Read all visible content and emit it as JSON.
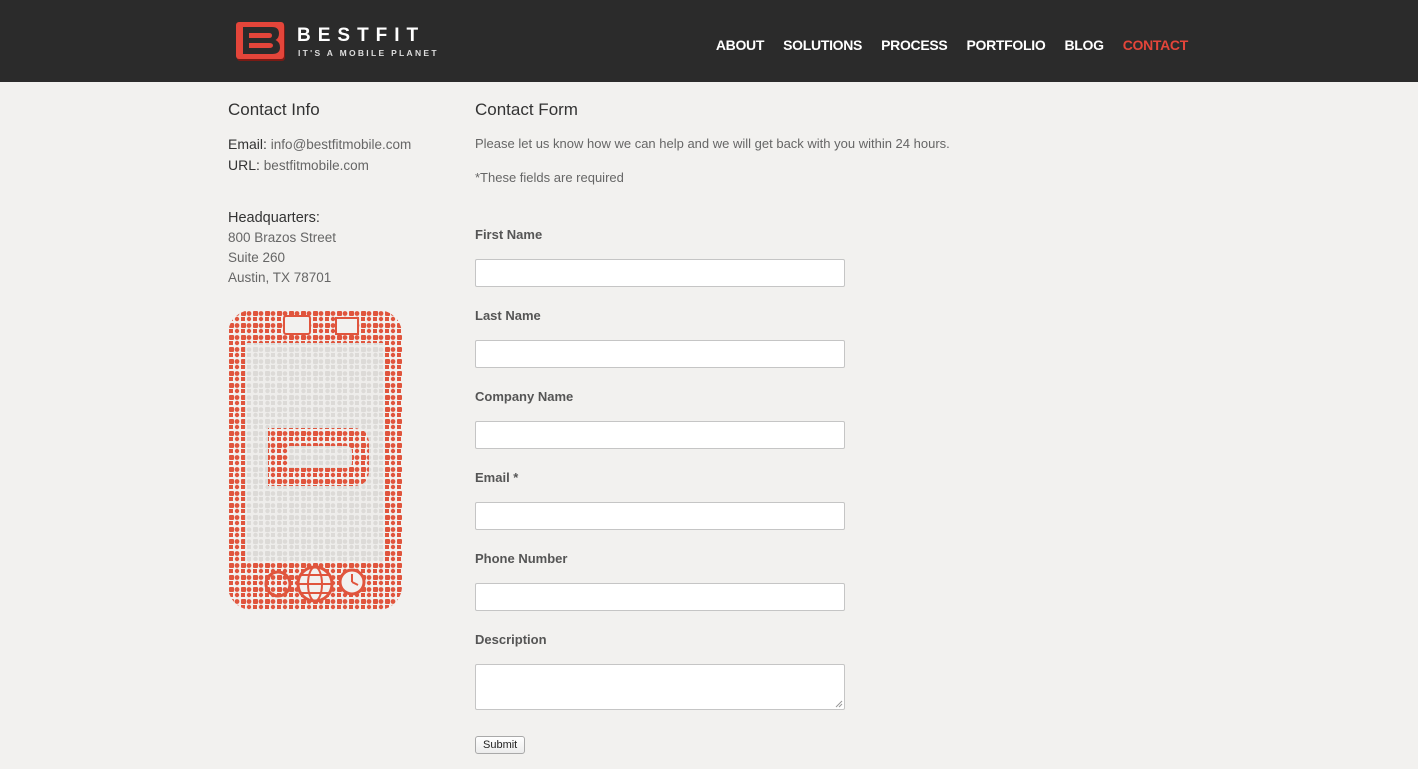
{
  "brand": {
    "name": "BESTFIT",
    "tagline": "IT'S A MOBILE PLANET",
    "colors": {
      "accent": "#e4453a",
      "header_bg": "#2b2b2b",
      "page_bg": "#f2f1ef"
    }
  },
  "nav": {
    "items": [
      {
        "label": "ABOUT"
      },
      {
        "label": "SOLUTIONS"
      },
      {
        "label": "PROCESS"
      },
      {
        "label": "PORTFOLIO"
      },
      {
        "label": "BLOG"
      },
      {
        "label": "CONTACT",
        "active": true
      }
    ]
  },
  "contact_info": {
    "title": "Contact Info",
    "email_label": "Email:",
    "email_value": "info@bestfitmobile.com",
    "url_label": "URL:",
    "url_value": "bestfitmobile.com",
    "hq_title": "Headquarters:",
    "hq_lines": [
      "800 Brazos Street",
      "Suite 260",
      "Austin, TX 78701"
    ]
  },
  "contact_form": {
    "title": "Contact Form",
    "intro": "Please let us know how we can help and we will get back with you within 24 hours.",
    "required_note": "*These fields are required",
    "fields": [
      {
        "label": "First Name",
        "value": ""
      },
      {
        "label": "Last Name",
        "value": ""
      },
      {
        "label": "Company Name",
        "value": ""
      },
      {
        "label": "Email *",
        "value": ""
      },
      {
        "label": "Phone Number",
        "value": ""
      },
      {
        "label": "Description",
        "value": ""
      }
    ],
    "submit_label": "Submit"
  }
}
